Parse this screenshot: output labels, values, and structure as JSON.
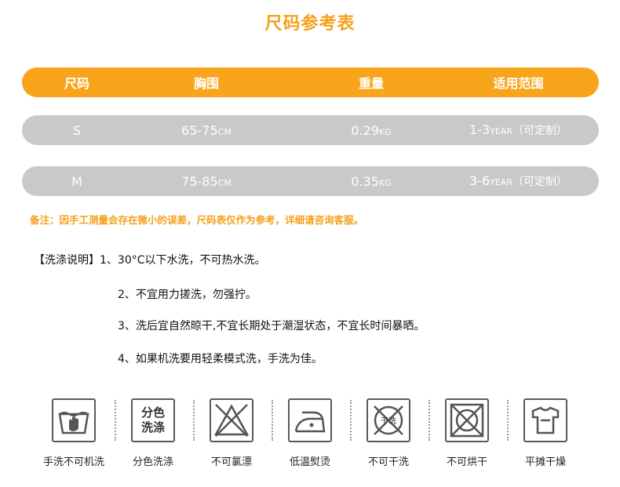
{
  "title": "尺码参考表",
  "table": {
    "headers": [
      "尺码",
      "胸围",
      "重量",
      "适用范围"
    ],
    "rows": [
      {
        "size": "S",
        "chest": "65-75",
        "chest_unit": "CM",
        "weight": "0.29",
        "weight_unit": "KG",
        "range": "1-3",
        "range_unit": "YEAR",
        "range_note": "（可定制）"
      },
      {
        "size": "M",
        "chest": "75-85",
        "chest_unit": "CM",
        "weight": "0.35",
        "weight_unit": "KG",
        "range": "3-6",
        "range_unit": "YEAR",
        "range_note": "（可定制）"
      }
    ]
  },
  "remark": "备注：因手工测量会存在微小的误差，尺码表仅作为参考，详细请咨询客服。",
  "wash_instructions": {
    "line1": "【洗涤说明】1、30°C以下水洗，不可热水洗。",
    "line2": "2、不宜用力搓洗，勿强拧。",
    "line3": "3、洗后宜自然晾干,不宜长期处于潮湿状态，不宜长时间暴晒。",
    "line4": "4、如果机洗要用轻柔模式洗，手洗为佳。"
  },
  "care_icons": [
    {
      "icon": "hand-wash-icon",
      "label": "手洗不可机洗"
    },
    {
      "icon": "separate-wash-icon",
      "label": "分色洗涤",
      "icon_text_1": "分色",
      "icon_text_2": "洗涤"
    },
    {
      "icon": "no-bleach-icon",
      "label": "不可氯漂"
    },
    {
      "icon": "low-iron-icon",
      "label": "低温熨烫"
    },
    {
      "icon": "no-dry-clean-icon",
      "label": "不可干洗",
      "icon_text": "干洗"
    },
    {
      "icon": "no-tumble-dry-icon",
      "label": "不可烘干"
    },
    {
      "icon": "flat-dry-icon",
      "label": "平摊干燥"
    }
  ],
  "colors": {
    "accent": "#f9a51c",
    "gray": "#c9c9c9"
  }
}
